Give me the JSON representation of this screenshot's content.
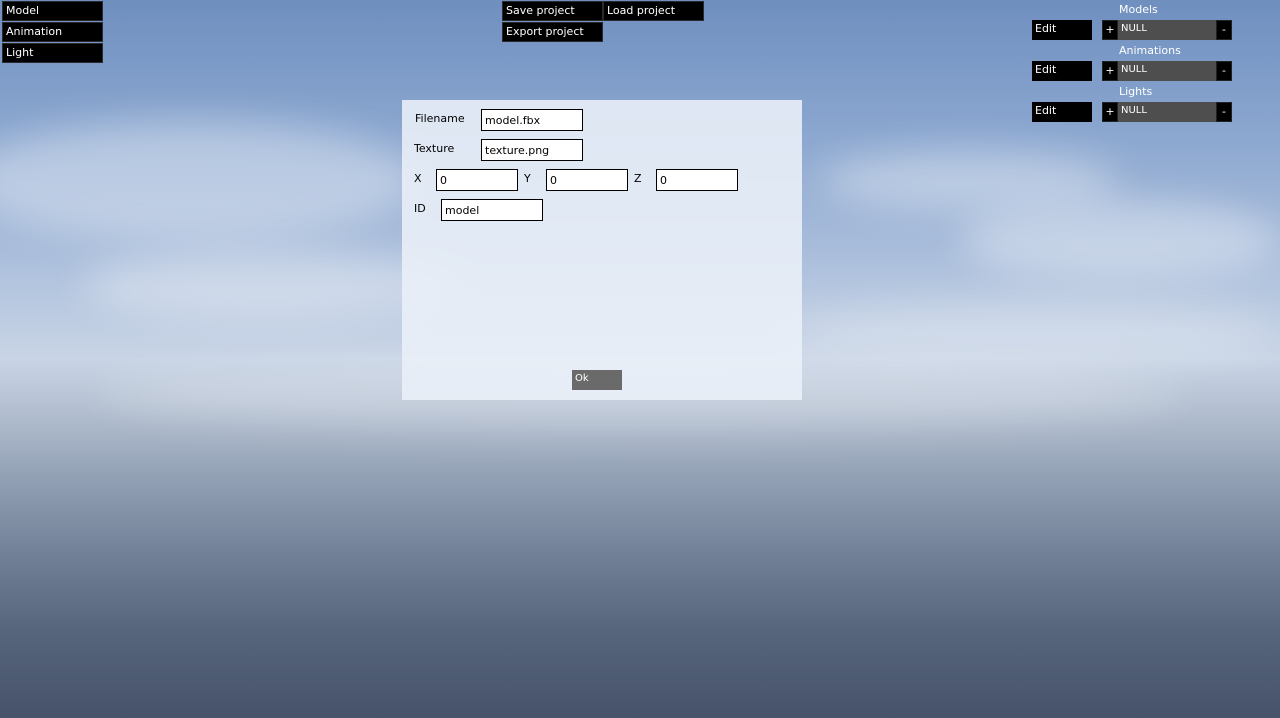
{
  "left_menu": [
    "Model",
    "Animation",
    "Light"
  ],
  "file_menu": {
    "save": "Save project",
    "load": "Load project",
    "export": "Export project"
  },
  "right_panel": [
    {
      "title": "Models",
      "edit": "Edit",
      "plus": "+",
      "value": "NULL",
      "minus": "-"
    },
    {
      "title": "Animations",
      "edit": "Edit",
      "plus": "+",
      "value": "NULL",
      "minus": "-"
    },
    {
      "title": "Lights",
      "edit": "Edit",
      "plus": "+",
      "value": "NULL",
      "minus": "-"
    }
  ],
  "dialog": {
    "filename_label": "Filename",
    "filename_value": "model.fbx",
    "texture_label": "Texture",
    "texture_value": "texture.png",
    "x_label": "X",
    "x_value": "0",
    "y_label": "Y",
    "y_value": "0",
    "z_label": "Z",
    "z_value": "0",
    "id_label": "ID",
    "id_value": "model",
    "ok_label": "Ok"
  }
}
